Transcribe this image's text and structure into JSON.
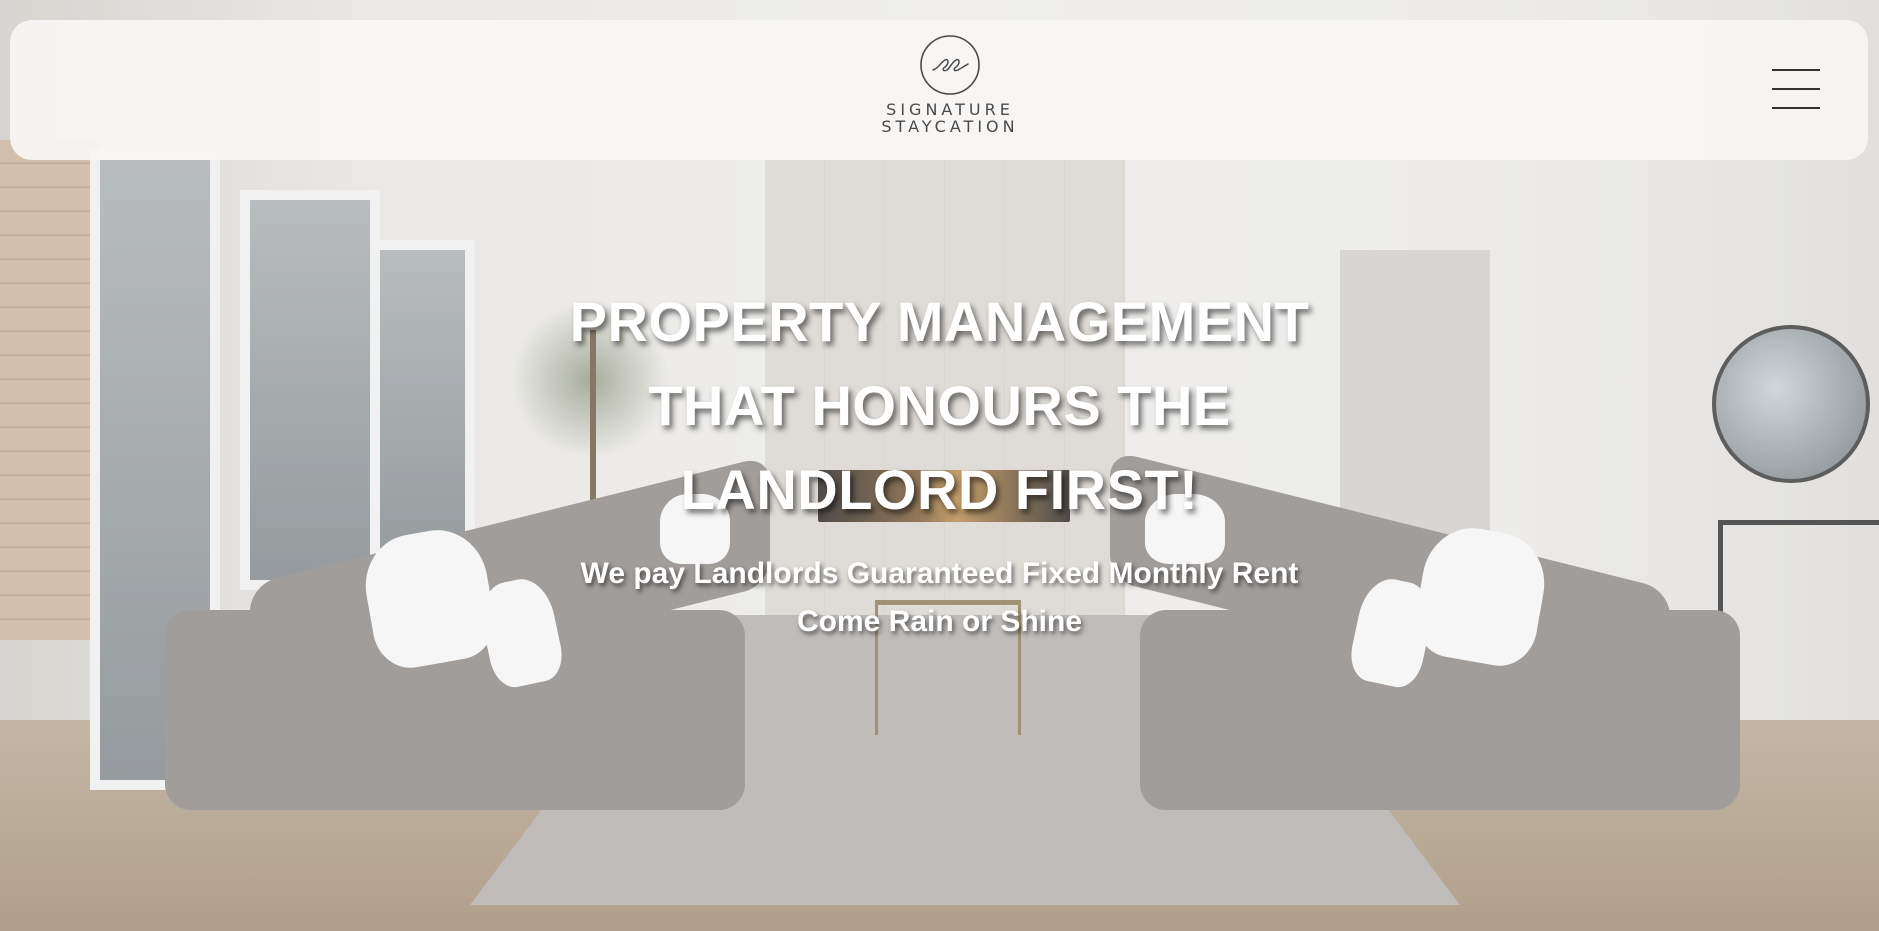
{
  "header": {
    "logo": {
      "monogram": "ss",
      "line1": "SIGNATURE",
      "line2": "STAYCATION"
    },
    "menu_icon": "hamburger-menu-icon"
  },
  "hero": {
    "title_lines": [
      "PROPERTY MANAGEMENT",
      "THAT HONOURS THE",
      "LANDLORD FIRST!"
    ],
    "subtitle_lines": [
      "We pay Landlords Guaranteed Fixed Monthly Rent",
      "Come Rain or Shine"
    ],
    "background_image": "living-room-photo"
  },
  "colors": {
    "header_bg": "#f7f6f5",
    "text_dark": "#4a4a4a",
    "hero_text": "#ffffff"
  }
}
